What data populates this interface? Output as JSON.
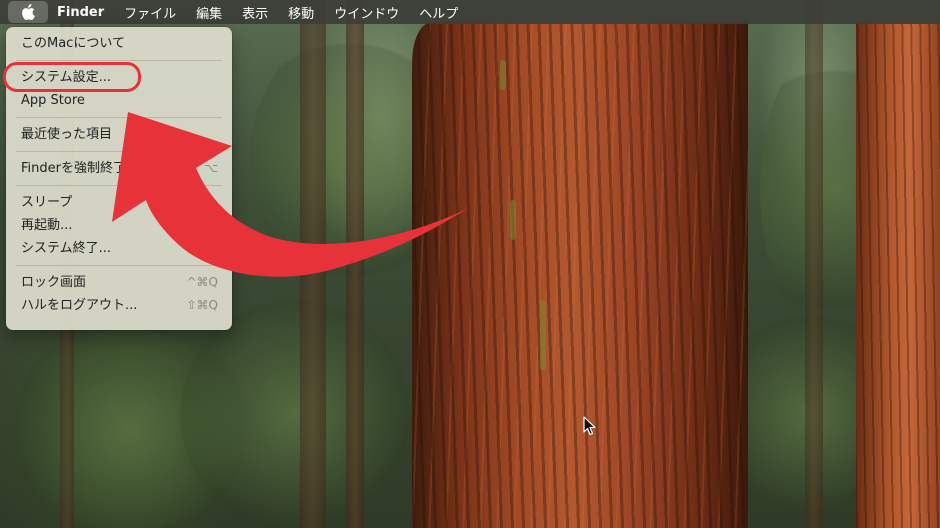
{
  "menubar": {
    "apple_icon": "apple-logo-icon",
    "app_name": "Finder",
    "items": [
      "ファイル",
      "編集",
      "表示",
      "移動",
      "ウインドウ",
      "ヘルプ"
    ]
  },
  "apple_menu": {
    "about": "このMacについて",
    "system_settings": "システム設定...",
    "app_store": "App Store",
    "recent_items": "最近使った項目",
    "force_quit": "Finderを強制終了",
    "force_quit_shortcut": "⌥",
    "sleep": "スリープ",
    "restart": "再起動...",
    "shutdown": "システム終了...",
    "lock_screen": "ロック画面",
    "lock_screen_shortcut": "^⌘Q",
    "logout": "ハルをログアウト...",
    "logout_shortcut": "⇧⌘Q"
  },
  "annotation": {
    "highlight_color": "#e8323a",
    "arrow_color": "#e8323a"
  }
}
